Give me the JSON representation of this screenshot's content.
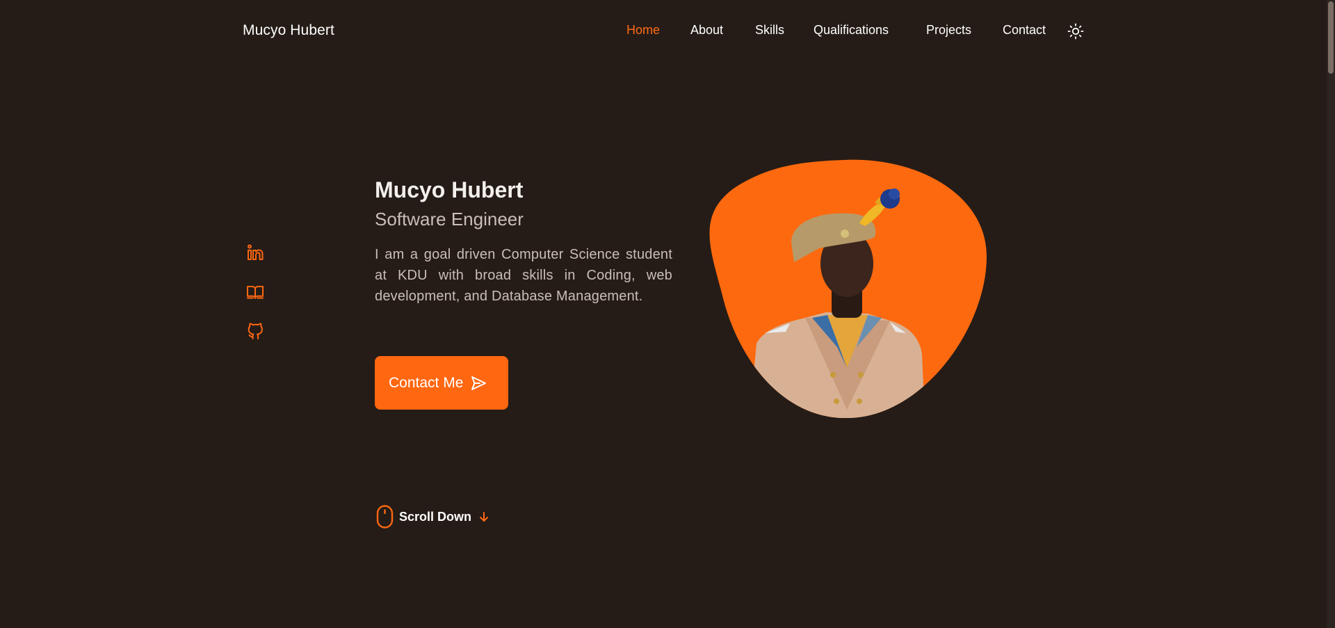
{
  "header": {
    "logo": "Mucyo Hubert",
    "nav": [
      {
        "label": "Home",
        "active": true
      },
      {
        "label": "About",
        "active": false
      },
      {
        "label": "Skills",
        "active": false
      },
      {
        "label": "Qualifications",
        "active": false
      },
      {
        "label": "Projects",
        "active": false
      },
      {
        "label": "Contact",
        "active": false
      }
    ],
    "theme_icon": "sun-icon"
  },
  "social": [
    {
      "name": "linkedin-icon"
    },
    {
      "name": "book-icon"
    },
    {
      "name": "github-icon"
    }
  ],
  "hero": {
    "name": "Mucyo Hubert",
    "role": "Software Engineer",
    "description": "I am a goal driven Computer Science student at KDU with broad skills in Coding, web development, and Database Management.",
    "button_label": "Contact Me",
    "button_icon": "send-icon",
    "scroll_label": "Scroll Down"
  },
  "colors": {
    "background": "#251c17",
    "accent": "#ff6711",
    "text": "#ffffff",
    "muted_text": "#c9bfb8"
  }
}
